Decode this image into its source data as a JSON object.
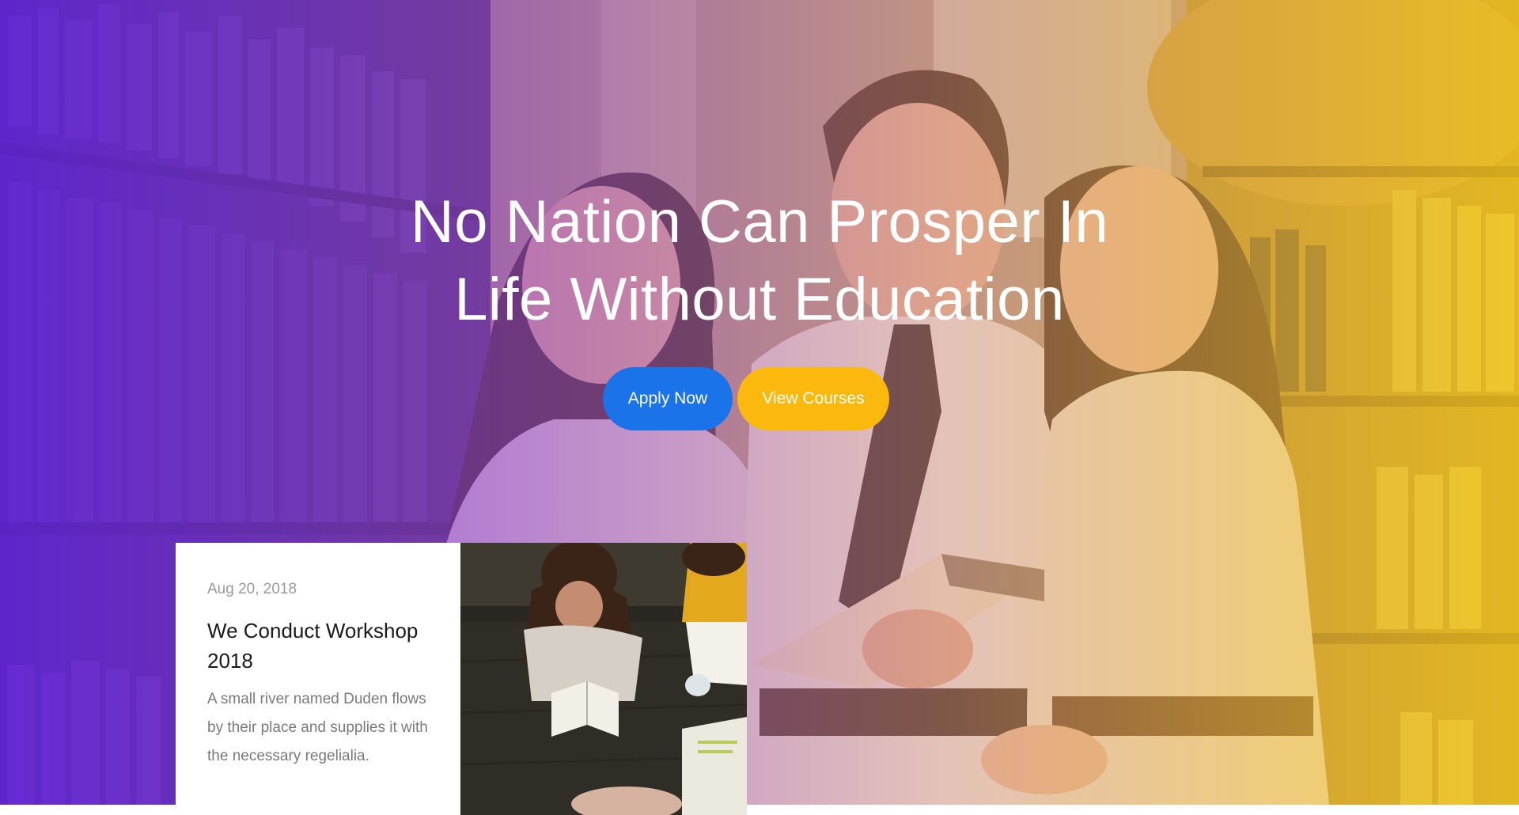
{
  "hero": {
    "title_line1": "No Nation Can Prosper In",
    "title_line2": "Life Without Education",
    "apply_label": "Apply Now",
    "courses_label": "View Courses",
    "gradient_start": "#6824e6",
    "gradient_end": "#f5c81e"
  },
  "post": {
    "date": "Aug 20, 2018",
    "title": "We Conduct Workshop 2018",
    "excerpt": "A small river named Duden flows by their place and supplies it with the necessary regelialia."
  },
  "colors": {
    "primary": "#1a73e8",
    "accent": "#fbb90e"
  },
  "icons": {
    "hero_image": "students-library-photo",
    "post_image": "students-reading-photo"
  }
}
